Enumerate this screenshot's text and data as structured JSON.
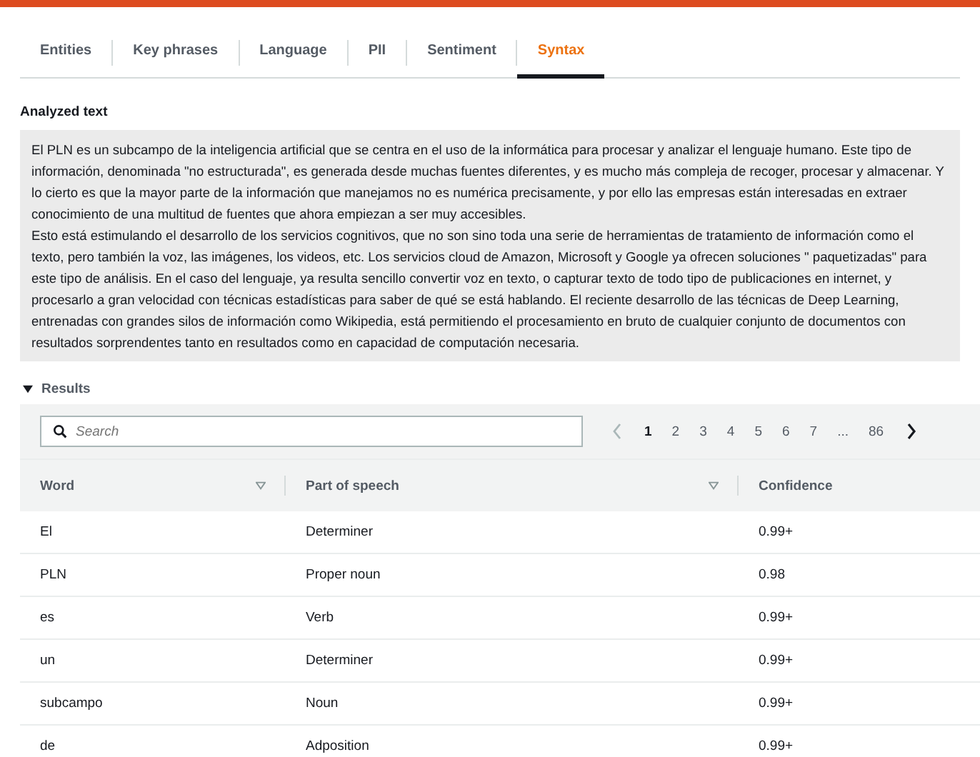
{
  "tabs": [
    {
      "label": "Entities",
      "selected": false
    },
    {
      "label": "Key phrases",
      "selected": false
    },
    {
      "label": "Language",
      "selected": false
    },
    {
      "label": "PII",
      "selected": false
    },
    {
      "label": "Sentiment",
      "selected": false
    },
    {
      "label": "Syntax",
      "selected": true
    }
  ],
  "analyzed_text": {
    "title": "Analyzed text",
    "paragraphs": [
      "El PLN es un subcampo de la inteligencia artificial que se centra en el uso de la informática para procesar y analizar el lenguaje humano. Este tipo de información, denominada \"no estructurada\", es generada desde muchas fuentes diferentes, y es mucho más compleja de recoger, procesar y almacenar. Y lo cierto es que la mayor parte de la información que manejamos no es numérica precisamente, y por ello las empresas están interesadas en extraer conocimiento de una multitud de fuentes que ahora empiezan a ser muy accesibles.",
      "Esto está estimulando el desarrollo de los servicios cognitivos, que no son sino toda una serie de herramientas de tratamiento de información como el texto, pero también la voz, las imágenes, los videos, etc. Los servicios cloud de Amazon, Microsoft y Google ya ofrecen soluciones \" paquetizadas\" para este tipo de análisis. En el caso del lenguaje, ya resulta sencillo convertir voz en texto, o capturar texto de todo tipo de publicaciones en internet, y procesarlo a gran velocidad con técnicas estadísticas para saber de qué se está hablando. El reciente desarrollo de las técnicas de Deep Learning, entrenadas con grandes silos de información como Wikipedia, está permitiendo el procesamiento en bruto de cualquier conjunto de documentos con resultados sorprendentes tanto en resultados como en capacidad de computación necesaria."
    ]
  },
  "results": {
    "title": "Results",
    "expanded": true,
    "search": {
      "placeholder": "Search"
    },
    "pages": [
      {
        "label": "1",
        "selected": true
      },
      {
        "label": "2",
        "selected": false
      },
      {
        "label": "3",
        "selected": false
      },
      {
        "label": "4",
        "selected": false
      },
      {
        "label": "5",
        "selected": false
      },
      {
        "label": "6",
        "selected": false
      },
      {
        "label": "7",
        "selected": false
      },
      {
        "label": "...",
        "selected": false
      },
      {
        "label": "86",
        "selected": false
      }
    ],
    "table": {
      "columns": [
        {
          "label": "Word",
          "sortable": true
        },
        {
          "label": "Part of speech",
          "sortable": true
        },
        {
          "label": "Confidence",
          "sortable": false
        }
      ],
      "rows": [
        [
          "El",
          "Determiner",
          "0.99+"
        ],
        [
          "PLN",
          "Proper noun",
          "0.98"
        ],
        [
          "es",
          "Verb",
          "0.99+"
        ],
        [
          "un",
          "Determiner",
          "0.99+"
        ],
        [
          "subcampo",
          "Noun",
          "0.99+"
        ],
        [
          "de",
          "Adposition",
          "0.99+"
        ]
      ]
    }
  }
}
